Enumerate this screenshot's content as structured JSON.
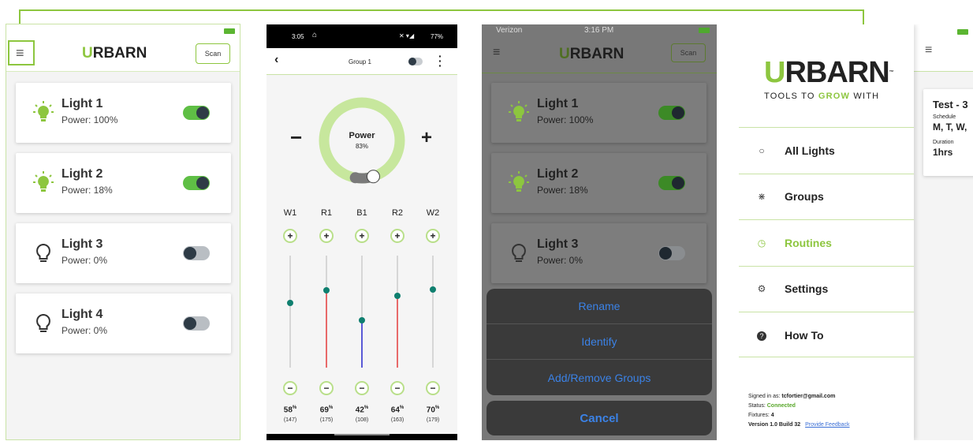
{
  "panel1": {
    "scan_label": "Scan",
    "lights": [
      {
        "name": "Light 1",
        "power": "Power: 100%",
        "on": true
      },
      {
        "name": "Light 2",
        "power": "Power: 18%",
        "on": true
      },
      {
        "name": "Light 3",
        "power": "Power: 0%",
        "on": false
      },
      {
        "name": "Light 4",
        "power": "Power: 0%",
        "on": false
      }
    ]
  },
  "logo": {
    "first": "U",
    "rest": "RBARN",
    "tagline_pre": "TOOLS TO ",
    "tagline_grow": "GROW",
    "tagline_post": " WITH"
  },
  "panel2": {
    "time": "3:05",
    "battery": "77%",
    "group_title": "Group 1",
    "minus": "−",
    "plus": "+",
    "power_label": "Power",
    "power_value": "83%",
    "power_level": 0.83,
    "channels": [
      {
        "name": "W1",
        "pct": "58",
        "count": "(147)",
        "level": 0.58,
        "color": "#d6d6d6"
      },
      {
        "name": "R1",
        "pct": "69",
        "count": "(175)",
        "level": 0.69,
        "color": "#e86a6a"
      },
      {
        "name": "B1",
        "pct": "42",
        "count": "(108)",
        "level": 0.42,
        "color": "#5a5ad6"
      },
      {
        "name": "R2",
        "pct": "64",
        "count": "(163)",
        "level": 0.64,
        "color": "#e86a6a"
      },
      {
        "name": "W2",
        "pct": "70",
        "count": "(179)",
        "level": 0.7,
        "color": "#d6d6d6"
      }
    ],
    "pct_symbol": "%"
  },
  "panel3": {
    "carrier": "Verizon",
    "time": "3:16 PM",
    "scan_label": "Scan",
    "lights": [
      {
        "name": "Light 1",
        "power": "Power: 100%"
      },
      {
        "name": "Light 2",
        "power": "Power: 18%"
      },
      {
        "name": "Light 3",
        "power": "Power: 0%"
      }
    ],
    "actions": [
      "Rename",
      "Identify",
      "Add/Remove Groups"
    ],
    "cancel": "Cancel"
  },
  "panel4": {
    "menu": [
      {
        "label": "All Lights",
        "active": false
      },
      {
        "label": "Groups",
        "active": false
      },
      {
        "label": "Routines",
        "active": true
      },
      {
        "label": "Settings",
        "active": false
      },
      {
        "label": "How To",
        "active": false
      }
    ],
    "signed_in_label": "Signed in as: ",
    "email": "tcfortier@gmail.com",
    "status_label": "Status: ",
    "status_value": "Connected",
    "fixtures_label": "Fixtures: ",
    "fixtures_value": "4",
    "version": "Version 1.0 Build 32",
    "feedback": "Provide Feedback",
    "routine": {
      "title": "Test - 3",
      "schedule_label": "Schedule",
      "schedule_value": "M, T, W,",
      "duration_label": "Duration",
      "duration_value": "1hrs"
    }
  },
  "colors": {
    "brand_green": "#8dc63f",
    "toggle_on": "#5fbf45",
    "ios_blue": "#3b82e6"
  }
}
